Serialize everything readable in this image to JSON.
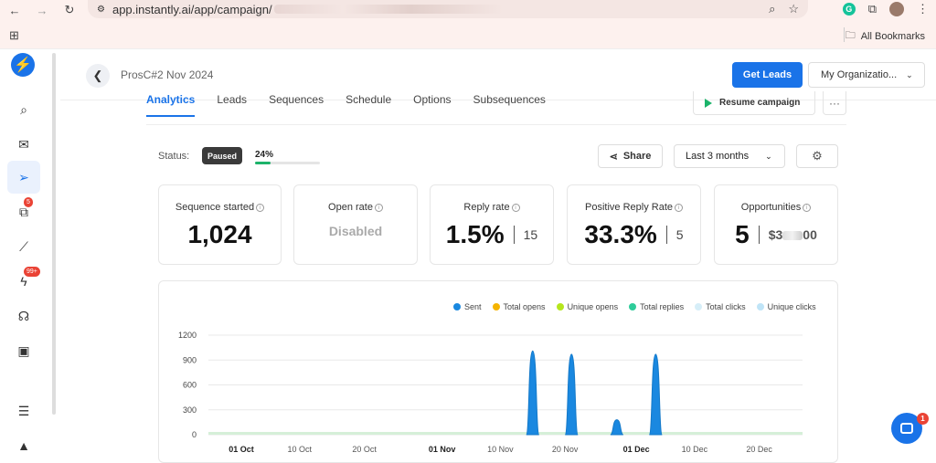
{
  "browser": {
    "url_prefix": "app.instantly.ai/app/campaign/",
    "bookmarks_label": "All Bookmarks"
  },
  "sidebar": {
    "items": [
      {
        "icon": "search-icon"
      },
      {
        "icon": "mail-icon"
      },
      {
        "icon": "send-icon",
        "active": true
      },
      {
        "icon": "copy-icon",
        "badge": "5"
      },
      {
        "icon": "analytics-icon"
      },
      {
        "icon": "bolt-icon",
        "badge": "99+"
      },
      {
        "icon": "robot-icon"
      },
      {
        "icon": "inbox-icon"
      },
      {
        "icon": "feedback-icon"
      },
      {
        "icon": "rocket-icon"
      }
    ]
  },
  "header": {
    "campaign_title": "ProsC#2 Nov 2024",
    "get_leads_label": "Get Leads",
    "org_label": "My Organizatio..."
  },
  "tabs": [
    "Analytics",
    "Leads",
    "Sequences",
    "Schedule",
    "Options",
    "Subsequences"
  ],
  "actions": {
    "resume_label": "Resume campaign"
  },
  "status": {
    "label": "Status:",
    "value": "Paused",
    "progress_text": "24%",
    "progress": 0.24
  },
  "controls": {
    "share_label": "Share",
    "range_label": "Last 3 months"
  },
  "stats": [
    {
      "title": "Sequence started",
      "value": "1,024"
    },
    {
      "title": "Open rate",
      "value": "Disabled"
    },
    {
      "title": "Reply rate",
      "value": "1.5%",
      "sub": "15"
    },
    {
      "title": "Positive Reply Rate",
      "value": "33.3%",
      "sub": "5"
    },
    {
      "title": "Opportunities",
      "value": "5",
      "sub_prefix": "$3",
      "sub_suffix": "00"
    }
  ],
  "colors": {
    "accent": "#1a73e8",
    "green": "#1cb36a"
  },
  "chart_data": {
    "type": "area",
    "legend": [
      {
        "name": "Sent",
        "color": "#1a88e0"
      },
      {
        "name": "Total opens",
        "color": "#f5b400"
      },
      {
        "name": "Unique opens",
        "color": "#b5e61d"
      },
      {
        "name": "Total replies",
        "color": "#2ecc9a"
      },
      {
        "name": "Total clicks",
        "color": "#d6eef8"
      },
      {
        "name": "Unique clicks",
        "color": "#bfe4f7"
      }
    ],
    "yticks": [
      "1200",
      "900",
      "600",
      "300",
      "0"
    ],
    "ylim": [
      0,
      1200
    ],
    "xticks": [
      {
        "label": "01 Oct",
        "bold": true,
        "day": 0
      },
      {
        "label": "10 Oct",
        "bold": false,
        "day": 9
      },
      {
        "label": "20 Oct",
        "bold": false,
        "day": 19
      },
      {
        "label": "01 Nov",
        "bold": true,
        "day": 31
      },
      {
        "label": "10 Nov",
        "bold": false,
        "day": 40
      },
      {
        "label": "20 Nov",
        "bold": false,
        "day": 50
      },
      {
        "label": "01 Dec",
        "bold": true,
        "day": 61
      },
      {
        "label": "10 Dec",
        "bold": false,
        "day": 70
      },
      {
        "label": "20 Dec",
        "bold": false,
        "day": 80
      }
    ],
    "series": [
      {
        "name": "Sent",
        "peaks": [
          {
            "day": 45,
            "value": 1010
          },
          {
            "day": 51,
            "value": 970
          },
          {
            "day": 58,
            "value": 180
          },
          {
            "day": 64,
            "value": 970
          }
        ]
      }
    ]
  }
}
